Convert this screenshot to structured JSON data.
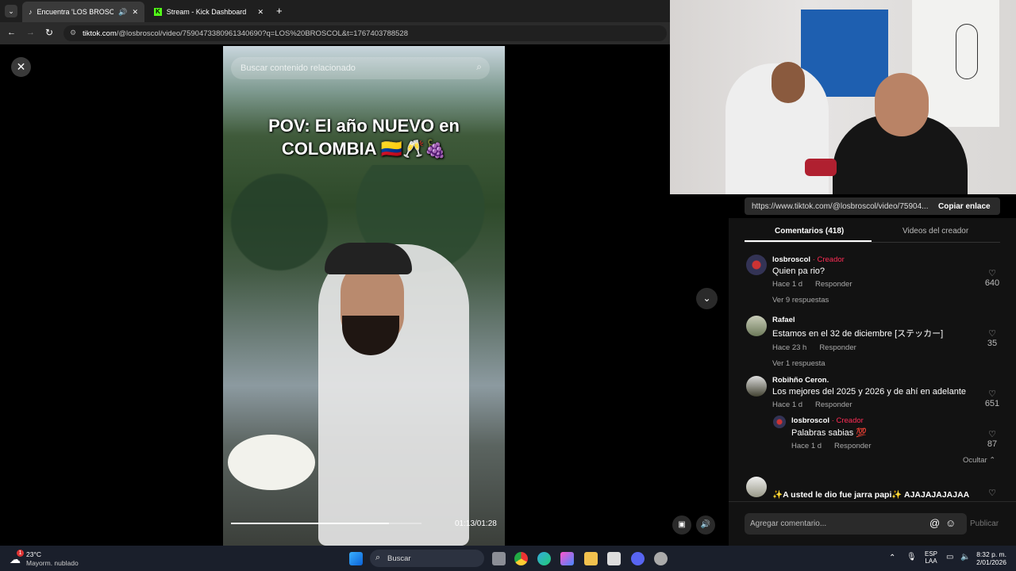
{
  "browser": {
    "tabs": [
      {
        "label": "Encuentra 'LOS BROSCOL' e"
      },
      {
        "label": "Stream - Kick Dashboard"
      }
    ],
    "new_tab": "+",
    "url_host": "tiktok.com",
    "url_path": "/@losbroscol/video/7590473380961340690?q=LOS%20BROSCOL&t=1767403788528"
  },
  "video": {
    "search_placeholder": "Buscar contenido relacionado",
    "caption_line1": "POV: El año NUEVO en",
    "caption_line2": "COLOMBIA 🇨🇴🥂🍇",
    "time": "01:13/01:28",
    "progress": 0.83
  },
  "share": {
    "link": "https://www.tiktok.com/@losbroscol/video/75904...",
    "copy_label": "Copiar enlace"
  },
  "tabs": {
    "comments": "Comentarios (418)",
    "creator_videos": "Videos del creador"
  },
  "comments": [
    {
      "user": "losbroscol",
      "badge": "· Creador",
      "text": "Quien pa rio?",
      "time": "Hace 1 d",
      "reply": "Responder",
      "likes": "640",
      "replies": "Ver 9 respuestas"
    },
    {
      "user": "Rafael",
      "badge": "",
      "text": "Estamos en el 32 de diciembre [ステッカー]",
      "time": "Hace 23 h",
      "reply": "Responder",
      "likes": "35",
      "replies": "Ver 1 respuesta"
    },
    {
      "user": "Robihño Ceron.",
      "badge": "",
      "text": "Los mejores del 2025 y 2026 y de ahí en adelante",
      "time": "Hace 1 d",
      "reply": "Responder",
      "likes": "651",
      "replies": ""
    },
    {
      "user": "losbroscol",
      "badge": "· Creador",
      "text": "Palabras sabias 💯",
      "time": "Hace 1 d",
      "reply": "Responder",
      "likes": "87",
      "replies": ""
    },
    {
      "user": "",
      "badge": "",
      "text": "✨A usted le dio fue jarra papi✨ AJAJAJAJAJAA",
      "time": "",
      "reply": "",
      "likes": "",
      "replies": ""
    }
  ],
  "hide_label": "Ocultar",
  "composer": {
    "placeholder": "Agregar comentario...",
    "post": "Publicar"
  },
  "taskbar": {
    "temp": "23°C",
    "weather": "Mayorm. nublado",
    "search": "Buscar",
    "lang1": "ESP",
    "lang2": "LAA",
    "time": "8:32 p. m.",
    "date": "2/01/2026",
    "notif": "1"
  },
  "colors": {
    "creator": "#fe2c55",
    "accent_white": "#ffffff",
    "taskbar": "#1a1f2b"
  }
}
